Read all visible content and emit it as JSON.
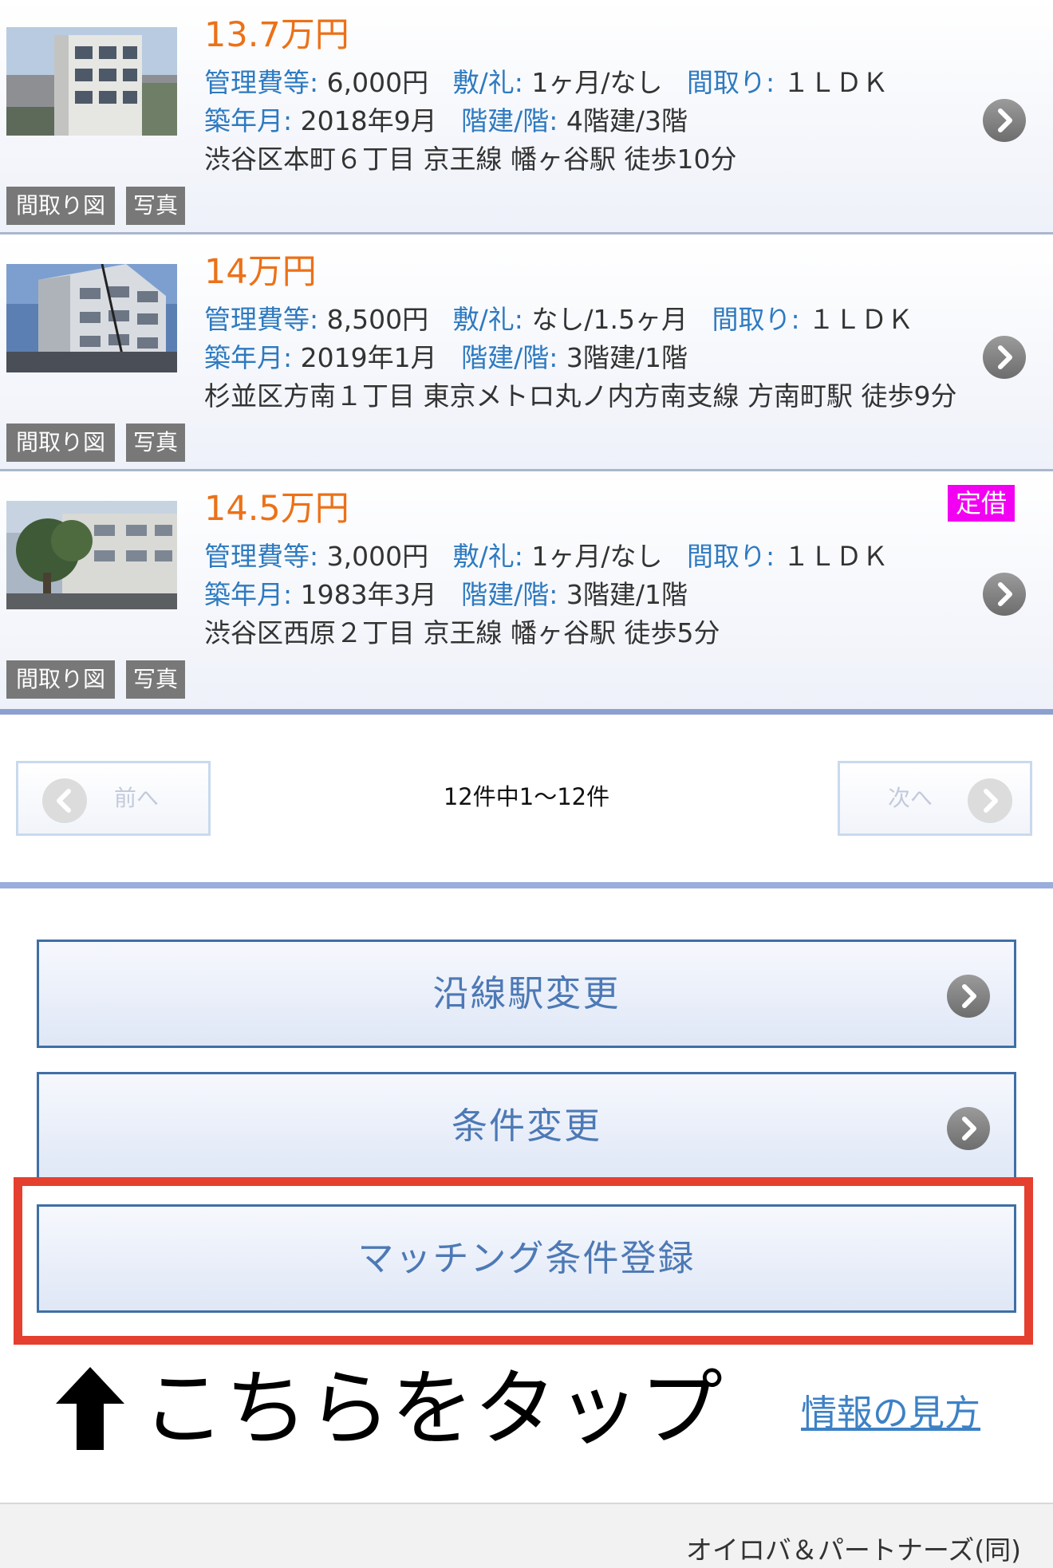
{
  "listings": [
    {
      "price": "13.7万円",
      "mgmt_label": "管理費等:",
      "mgmt_value": "6,000円",
      "deposit_label": "敷/礼:",
      "deposit_value": "1ヶ月/なし",
      "layout_label": "間取り:",
      "layout_value": "１ＬＤＫ",
      "built_label": "築年月:",
      "built_value": "2018年9月",
      "floor_label": "階建/階:",
      "floor_value": "4階建/3階",
      "address": "渋谷区本町６丁目 京王線 幡ヶ谷駅 徒歩10分",
      "tag_floorplan": "間取り図",
      "tag_photo": "写真",
      "badge": ""
    },
    {
      "price": "14万円",
      "mgmt_label": "管理費等:",
      "mgmt_value": "8,500円",
      "deposit_label": "敷/礼:",
      "deposit_value": "なし/1.5ヶ月",
      "layout_label": "間取り:",
      "layout_value": "１ＬＤＫ",
      "built_label": "築年月:",
      "built_value": "2019年1月",
      "floor_label": "階建/階:",
      "floor_value": "3階建/1階",
      "address": "杉並区方南１丁目 東京メトロ丸ノ内方南支線 方南町駅 徒歩9分",
      "tag_floorplan": "間取り図",
      "tag_photo": "写真",
      "badge": ""
    },
    {
      "price": "14.5万円",
      "mgmt_label": "管理費等:",
      "mgmt_value": "3,000円",
      "deposit_label": "敷/礼:",
      "deposit_value": "1ヶ月/なし",
      "layout_label": "間取り:",
      "layout_value": "１ＬＤＫ",
      "built_label": "築年月:",
      "built_value": "1983年3月",
      "floor_label": "階建/階:",
      "floor_value": "3階建/1階",
      "address": "渋谷区西原２丁目 京王線 幡ヶ谷駅 徒歩5分",
      "tag_floorplan": "間取り図",
      "tag_photo": "写真",
      "badge": "定借"
    }
  ],
  "pager": {
    "prev_label": "前へ",
    "next_label": "次へ",
    "count_text": "12件中1〜12件"
  },
  "actions": {
    "line_station_change": "沿線駅変更",
    "condition_change": "条件変更",
    "matching_register": "マッチング条件登録"
  },
  "annotation": {
    "tap_here": "こちらをタップ"
  },
  "help_link": "情報の見方",
  "footer": {
    "company": "オイロバ＆パートナーズ(同)"
  },
  "colors": {
    "price": "#ec7118",
    "label_blue": "#2e7ac0",
    "badge_magenta": "#f200f2",
    "highlight_red": "#e53f2f",
    "button_text": "#4d79b5"
  },
  "icons": [
    "chevron-right-circle-icon",
    "chevron-left-circle-icon",
    "up-arrow-icon"
  ]
}
